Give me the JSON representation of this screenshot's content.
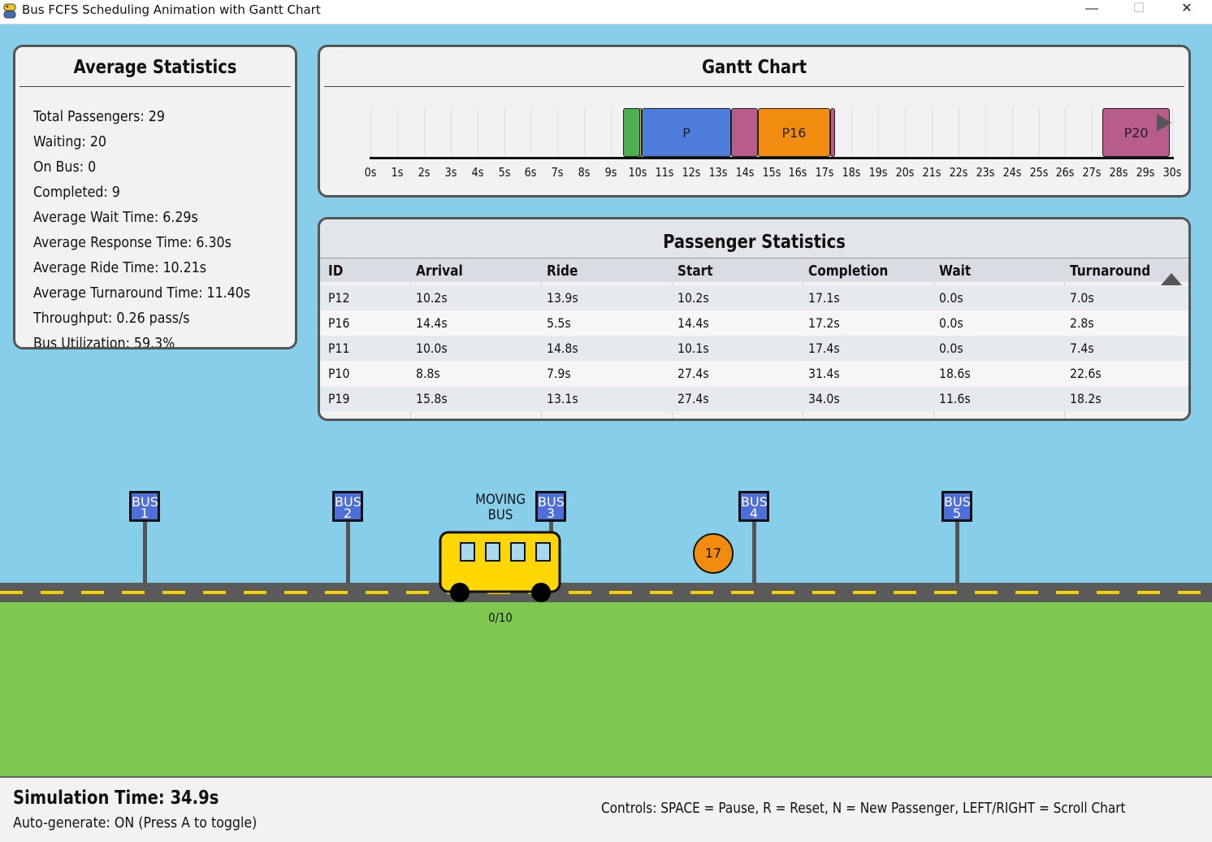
{
  "window": {
    "title": "Bus FCFS Scheduling Animation with Gantt Chart",
    "minimize": "—",
    "maximize": "☐",
    "close": "✕"
  },
  "avg_stats": {
    "title": "Average Statistics",
    "items": [
      "Total Passengers: 29",
      "Waiting: 20",
      "On Bus: 0",
      "Completed: 9",
      "Average Wait Time: 6.29s",
      "Average Response Time: 6.30s",
      "Average Ride Time: 10.21s",
      "Average Turnaround Time: 11.40s",
      "Throughput: 0.26 pass/s",
      "Bus Utilization: 59.3%"
    ]
  },
  "gantt": {
    "title": "Gantt Chart",
    "ticks": [
      "0s",
      "1s",
      "2s",
      "3s",
      "4s",
      "5s",
      "6s",
      "7s",
      "8s",
      "9s",
      "10s",
      "11s",
      "12s",
      "13s",
      "14s",
      "15s",
      "16s",
      "17s",
      "18s",
      "19s",
      "20s",
      "21s",
      "22s",
      "23s",
      "24s",
      "25s",
      "26s",
      "27s",
      "28s",
      "29s",
      "30s"
    ],
    "bars": [
      {
        "label": "",
        "start": 9.45,
        "end": 10.1,
        "color": "#4caf50"
      },
      {
        "label": "",
        "start": 10.05,
        "end": 10.15,
        "color": "#f0c020"
      },
      {
        "label": "P",
        "start": 10.15,
        "end": 13.5,
        "color": "#4f7ddb"
      },
      {
        "label": "",
        "start": 13.5,
        "end": 14.5,
        "color": "#b85c8c"
      },
      {
        "label": "P16",
        "start": 14.5,
        "end": 17.2,
        "color": "#f28c0f"
      },
      {
        "label": "",
        "start": 17.2,
        "end": 17.4,
        "color": "#b85c8c"
      },
      {
        "label": "P20",
        "start": 27.4,
        "end": 29.9,
        "color": "#b85c8c"
      }
    ]
  },
  "passenger_stats": {
    "title": "Passenger Statistics",
    "columns": [
      "ID",
      "Arrival",
      "Ride",
      "Start",
      "Completion",
      "Wait",
      "Turnaround"
    ],
    "rows": [
      [
        "P12",
        "10.2s",
        "13.9s",
        "10.2s",
        "17.1s",
        "0.0s",
        "7.0s"
      ],
      [
        "P16",
        "14.4s",
        "5.5s",
        "14.4s",
        "17.2s",
        "0.0s",
        "2.8s"
      ],
      [
        "P11",
        "10.0s",
        "14.8s",
        "10.1s",
        "17.4s",
        "0.0s",
        "7.4s"
      ],
      [
        "P10",
        "8.8s",
        "7.9s",
        "27.4s",
        "31.4s",
        "18.6s",
        "22.6s"
      ],
      [
        "P19",
        "15.8s",
        "13.1s",
        "27.4s",
        "34.0s",
        "11.6s",
        "18.2s"
      ]
    ]
  },
  "scene": {
    "stops": [
      {
        "label": "BUS",
        "num": "1"
      },
      {
        "label": "BUS",
        "num": "2"
      },
      {
        "label": "BUS",
        "num": "3"
      },
      {
        "label": "BUS",
        "num": "4"
      },
      {
        "label": "BUS",
        "num": "5"
      }
    ],
    "bus_status_line1": "MOVING",
    "bus_status_line2": "BUS",
    "bus_capacity": "0/10",
    "waiting_passenger": "17",
    "colors": {
      "sky": "#87ceeb",
      "grass": "#7ec850",
      "road": "#5a5a5a",
      "dash": "#f5d000",
      "bus": "#ffd700",
      "passenger": "#f28c0f"
    }
  },
  "footer": {
    "sim_time": "Simulation Time: 34.9s",
    "auto_generate": "Auto-generate: ON (Press A to toggle)",
    "controls": "Controls: SPACE = Pause, R = Reset, N = New Passenger, LEFT/RIGHT = Scroll Chart"
  }
}
